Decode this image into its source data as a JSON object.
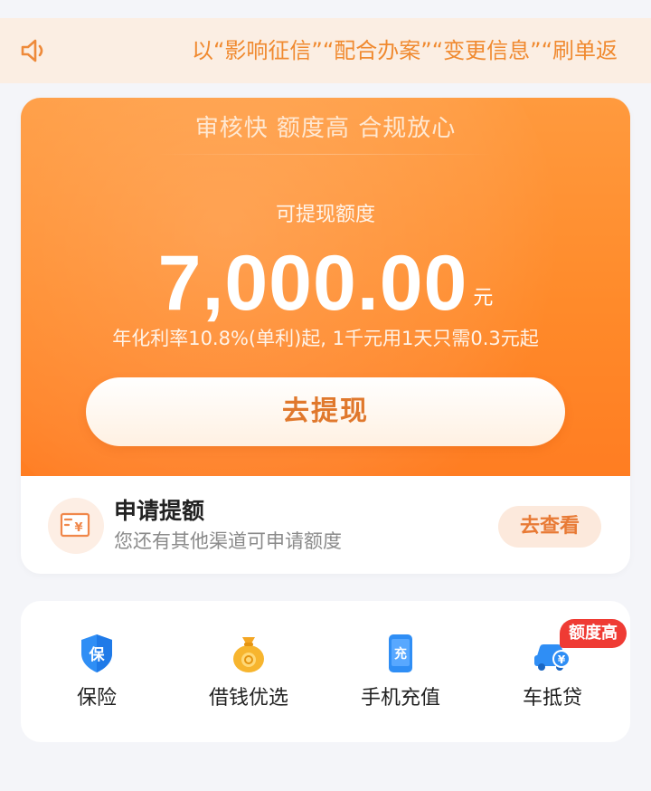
{
  "notice": {
    "text": "以“影响征信”“配合办案”“变更信息”“刷单返",
    "icon": "speaker-icon"
  },
  "hero": {
    "tagline": "审核快 额度高 合规放心",
    "limit_label": "可提现额度",
    "amount": "7,000.00",
    "amount_unit": "元",
    "rate_text": "年化利率10.8%(单利)起, 1千元用1天只需0.3元起",
    "withdraw_label": "去提现"
  },
  "apply": {
    "icon": "credit-card-yen-icon",
    "title": "申请提额",
    "subtitle": "您还有其他渠道可申请额度",
    "button_label": "去查看"
  },
  "services": [
    {
      "label": "保险",
      "icon": "insurance-shield-icon",
      "icon_text": "保"
    },
    {
      "label": "借钱优选",
      "icon": "money-bag-icon"
    },
    {
      "label": "手机充值",
      "icon": "phone-recharge-icon",
      "icon_text": "充"
    },
    {
      "label": "车抵贷",
      "icon": "car-loan-icon",
      "badge": "额度高"
    }
  ],
  "colors": {
    "accent_orange": "#ff8a2a",
    "notice_bg": "#fbeee3",
    "notice_text": "#f08a30",
    "badge_red": "#ef3b34",
    "icon_blue": "#2f8ef5"
  }
}
